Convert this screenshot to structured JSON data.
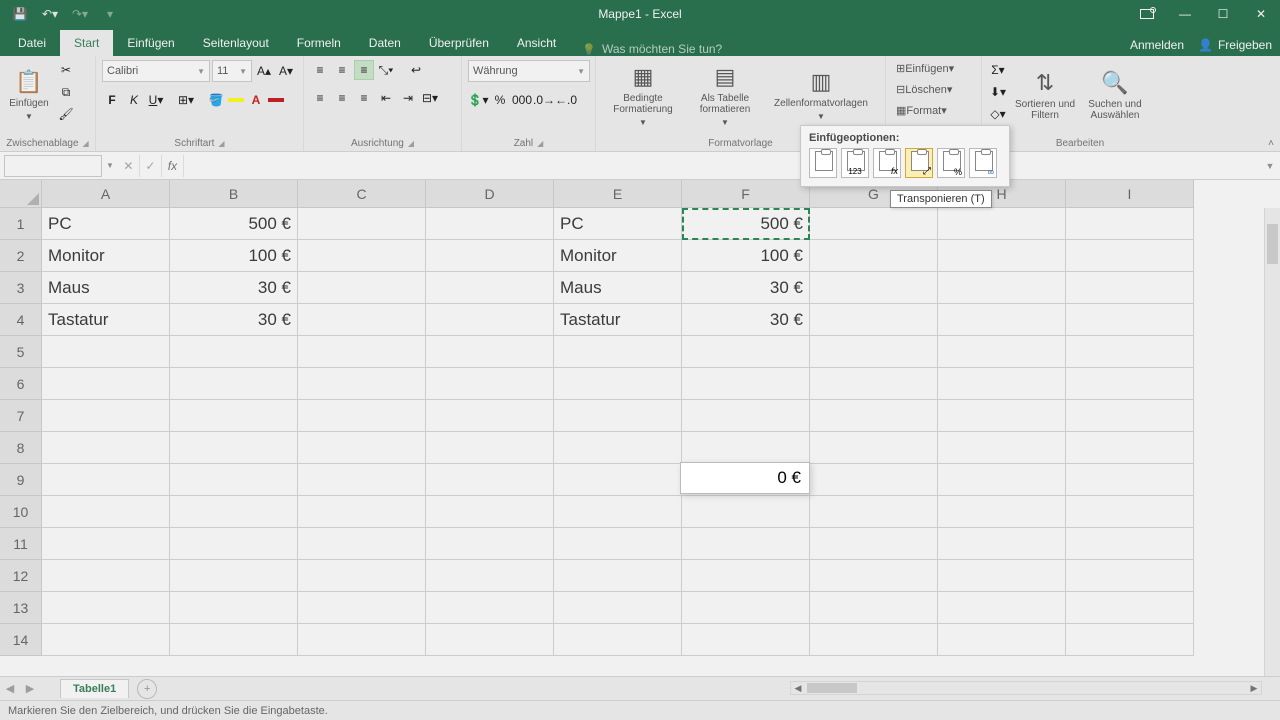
{
  "title": "Mappe1 - Excel",
  "tabs": {
    "file": "Datei",
    "home": "Start",
    "insert": "Einfügen",
    "page_layout": "Seitenlayout",
    "formulas": "Formeln",
    "data": "Daten",
    "review": "Überprüfen",
    "view": "Ansicht",
    "tell_me": "Was möchten Sie tun?",
    "signin": "Anmelden",
    "share": "Freigeben"
  },
  "ribbon": {
    "clipboard": {
      "paste_label": "Einfügen",
      "group": "Zwischenablage"
    },
    "font": {
      "family": "Calibri",
      "size": "11",
      "group": "Schriftart",
      "bold": "F",
      "italic": "K",
      "underline": "U"
    },
    "alignment": {
      "group": "Ausrichtung"
    },
    "number": {
      "format": "Währung",
      "group": "Zahl"
    },
    "styles": {
      "cond": "Bedingte Formatierung",
      "table": "Als Tabelle formatieren",
      "cellstyles": "Zellenformatvorlagen",
      "group": "Formatvorlage"
    },
    "cells": {
      "insert": "Einfügen",
      "delete": "Löschen",
      "format": "Format"
    },
    "editing": {
      "sort": "Sortieren und Filtern",
      "find": "Suchen und Auswählen",
      "group": "Bearbeiten"
    }
  },
  "paste_options": {
    "title": "Einfügeoptionen:",
    "tooltip": "Transponieren (T)",
    "opt_values": "123",
    "opt_formulas": "fx"
  },
  "columns": [
    "A",
    "B",
    "C",
    "D",
    "E",
    "F",
    "G",
    "H",
    "I"
  ],
  "rows": [
    "1",
    "2",
    "3",
    "4",
    "5",
    "6",
    "7",
    "8",
    "9",
    "10",
    "11",
    "12",
    "13",
    "14"
  ],
  "cells": {
    "A1": "PC",
    "B1": "500 €",
    "E1": "PC",
    "F1": "500 €",
    "A2": "Monitor",
    "B2": "100 €",
    "E2": "Monitor",
    "F2": "100 €",
    "A3": "Maus",
    "B3": "30 €",
    "E3": "Maus",
    "F3": "30 €",
    "A4": "Tastatur",
    "B4": "30 €",
    "E4": "Tastatur",
    "F4": "30 €"
  },
  "preview_value": "0 €",
  "sheet_tab": "Tabelle1",
  "status_text": "Markieren Sie den Zielbereich, und drücken Sie die Eingabetaste."
}
